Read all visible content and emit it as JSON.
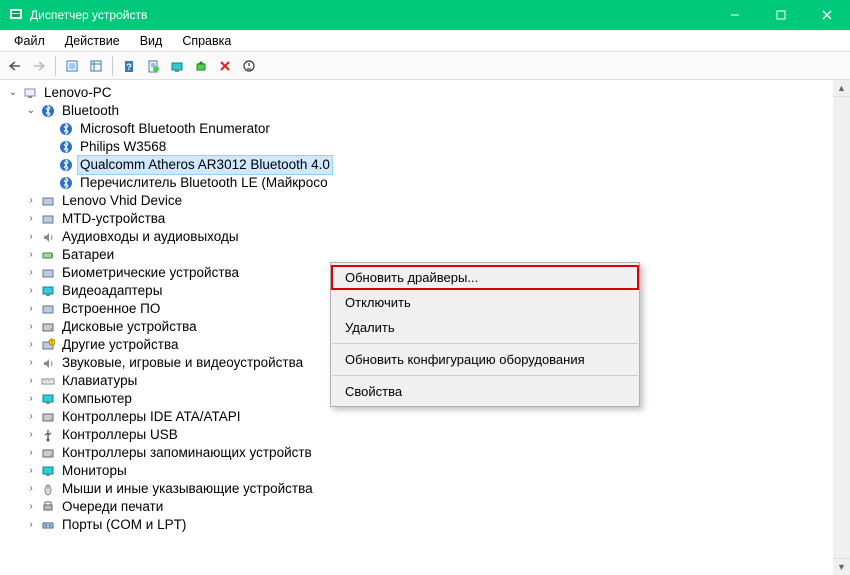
{
  "window": {
    "title": "Диспетчер устройств"
  },
  "menubar": {
    "file": "Файл",
    "action": "Действие",
    "view": "Вид",
    "help": "Справка"
  },
  "tree": {
    "root": "Lenovo-PC",
    "bluetooth": {
      "label": "Bluetooth",
      "items": [
        "Microsoft Bluetooth Enumerator",
        "Philips W3568",
        "Qualcomm Atheros AR3012 Bluetooth 4.0",
        "Перечислитель Bluetooth LE (Майкросо"
      ]
    },
    "categories": [
      "Lenovo Vhid Device",
      "MTD-устройства",
      "Аудиовходы и аудиовыходы",
      "Батареи",
      "Биометрические устройства",
      "Видеоадаптеры",
      "Встроенное ПО",
      "Дисковые устройства",
      "Другие устройства",
      "Звуковые, игровые и видеоустройства",
      "Клавиатуры",
      "Компьютер",
      "Контроллеры IDE ATA/ATAPI",
      "Контроллеры USB",
      "Контроллеры запоминающих устройств",
      "Мониторы",
      "Мыши и иные указывающие устройства",
      "Очереди печати",
      "Порты (COM и LPT)"
    ]
  },
  "contextMenu": {
    "updateDrivers": "Обновить драйверы...",
    "disable": "Отключить",
    "delete": "Удалить",
    "scanHardware": "Обновить конфигурацию оборудования",
    "properties": "Свойства"
  }
}
